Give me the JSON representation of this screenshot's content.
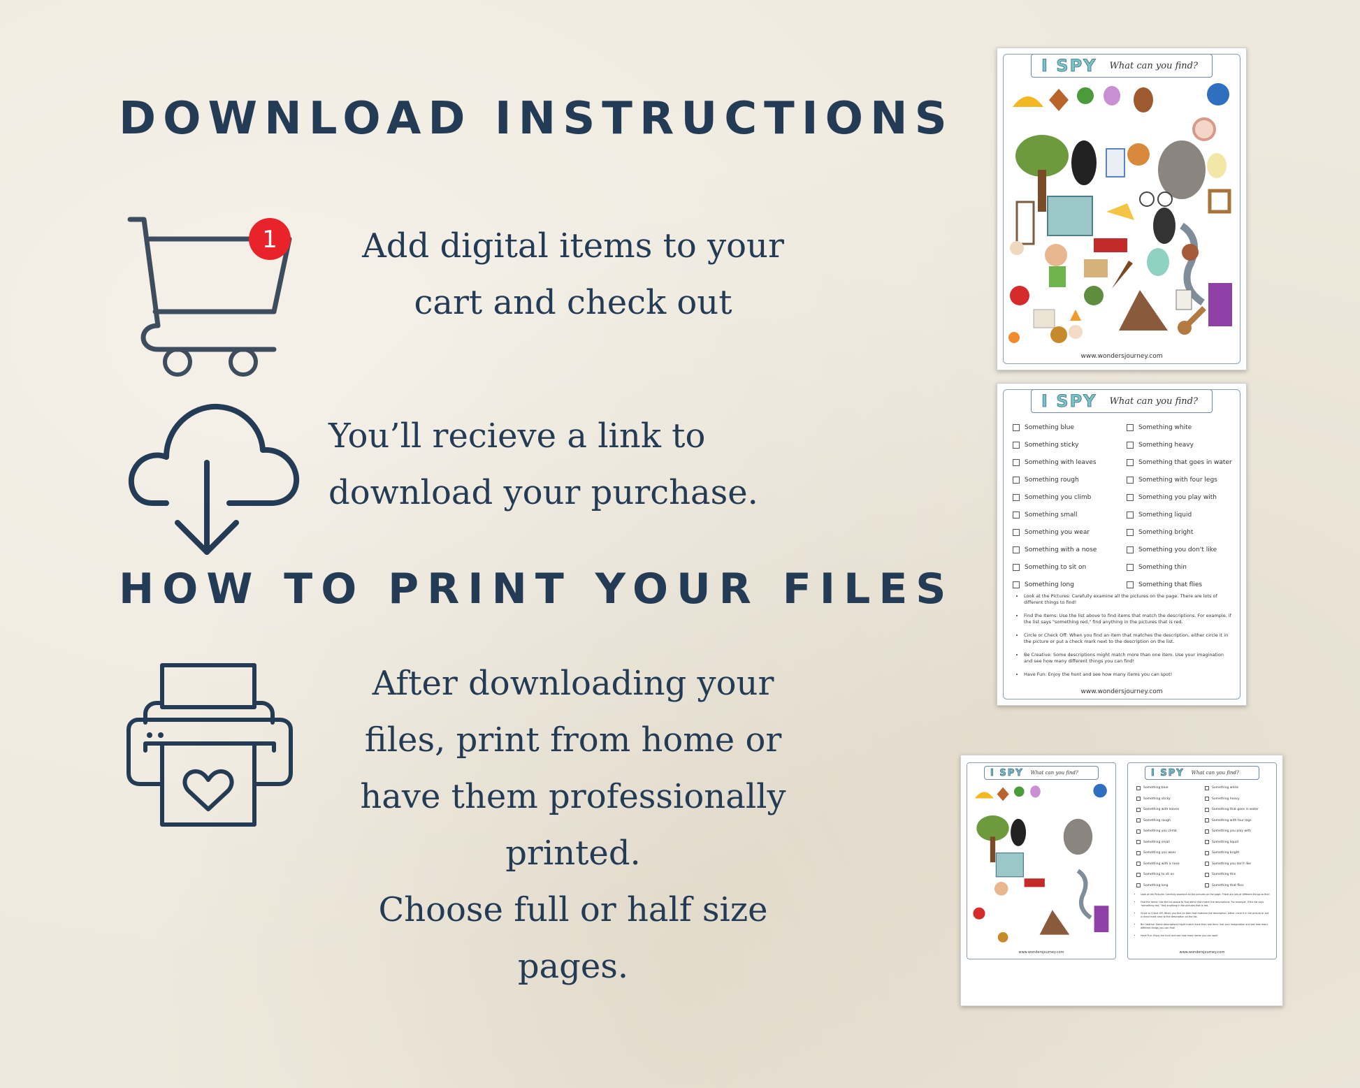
{
  "headings": {
    "download": "DOWNLOAD INSTRUCTIONS",
    "print": "HOW TO PRINT YOUR FILES"
  },
  "steps": {
    "cart": [
      "Add digital items to your",
      "cart and check out"
    ],
    "download": [
      "You’ll recieve a link to",
      "download your purchase."
    ],
    "print": [
      "After downloading your",
      "files, print from home or",
      "have them professionally",
      "printed.",
      "Choose full or half size",
      "pages."
    ]
  },
  "cart_badge": "1",
  "colors": {
    "ink": "#233b55",
    "badge": "#e8232a",
    "background": "#efe9dd"
  },
  "icons": [
    "shopping-cart-icon",
    "cloud-download-icon",
    "printer-heart-icon"
  ],
  "worksheet": {
    "title": "I SPY",
    "subtitle": "What can you find?",
    "website": "www.wondersjourney.com",
    "checklist": [
      "Something blue",
      "Something white",
      "Something sticky",
      "Something heavy",
      "Something with leaves",
      "Something that goes in water",
      "Something rough",
      "Something with four legs",
      "Something you climb",
      "Something you play with",
      "Something small",
      "Something liquid",
      "Something you wear",
      "Something bright",
      "Something with a nose",
      "Something you don't like",
      "Something to sit on",
      "Something thin",
      "Something long",
      "Something that flies"
    ],
    "instructions": [
      "Look at the Pictures: Carefully examine all the pictures on the page. There are lots of different things to find!",
      "Find the Items: Use the list above to find items that match the descriptions. For example, if the list says \"something red,\" find anything in the pictures that is red.",
      "Circle or Check Off: When you find an item that matches the description, either circle it in the picture or put a check mark next to the description on the list.",
      "Be Creative: Some descriptions might match more than one item. Use your imagination and see how many different things you can find!",
      "Have Fun: Enjoy the hunt and see how many items you can spot!"
    ]
  }
}
